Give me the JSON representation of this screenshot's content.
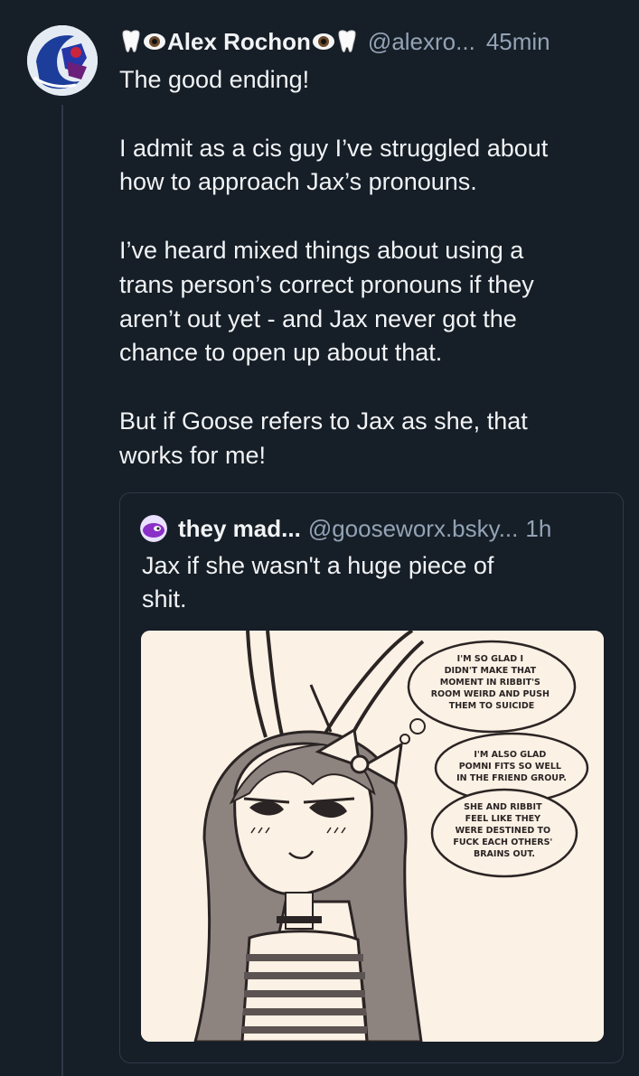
{
  "post": {
    "author": {
      "display_name": "Alex Rochon",
      "handle": "@alexro...",
      "name_emojis": [
        "tooth-emoji",
        "eye-emoji"
      ]
    },
    "time": "45min",
    "text_lines": [
      "The good ending!",
      "",
      "I admit as a cis guy I’ve struggled about",
      "how to approach Jax’s pronouns.",
      "",
      "I’ve heard mixed things about using a",
      "trans person’s correct pronouns if they",
      "aren’t out yet - and Jax never got the",
      "chance to open up about that.",
      "",
      "But if Goose refers to Jax as she, that",
      "works for me!"
    ]
  },
  "quote": {
    "display_name": "they mad...",
    "handle": "@gooseworx.bsky...",
    "time": "1h",
    "text_lines": [
      "Jax if she wasn't a huge piece of",
      "shit."
    ],
    "image": {
      "bubbles": [
        [
          "I'M SO GLAD I",
          "DIDN'T MAKE THAT",
          "MOMENT IN RIBBIT'S",
          "ROOM WEIRD AND PUSH",
          "THEM TO SUICIDE"
        ],
        [
          "I'M ALSO GLAD",
          "POMNI FITS SO WELL",
          "IN THE FRIEND GROUP."
        ],
        [
          "SHE AND RIBBIT",
          "FEEL LIKE THEY",
          "WERE DESTINED TO",
          "FUCK EACH OTHERS'",
          "BRAINS OUT."
        ]
      ]
    }
  },
  "colors": {
    "background": "#161e27",
    "text": "#f1f3f5",
    "muted": "#93a3b5",
    "border": "#2e3a48",
    "image_bg": "#fbf1e4"
  }
}
